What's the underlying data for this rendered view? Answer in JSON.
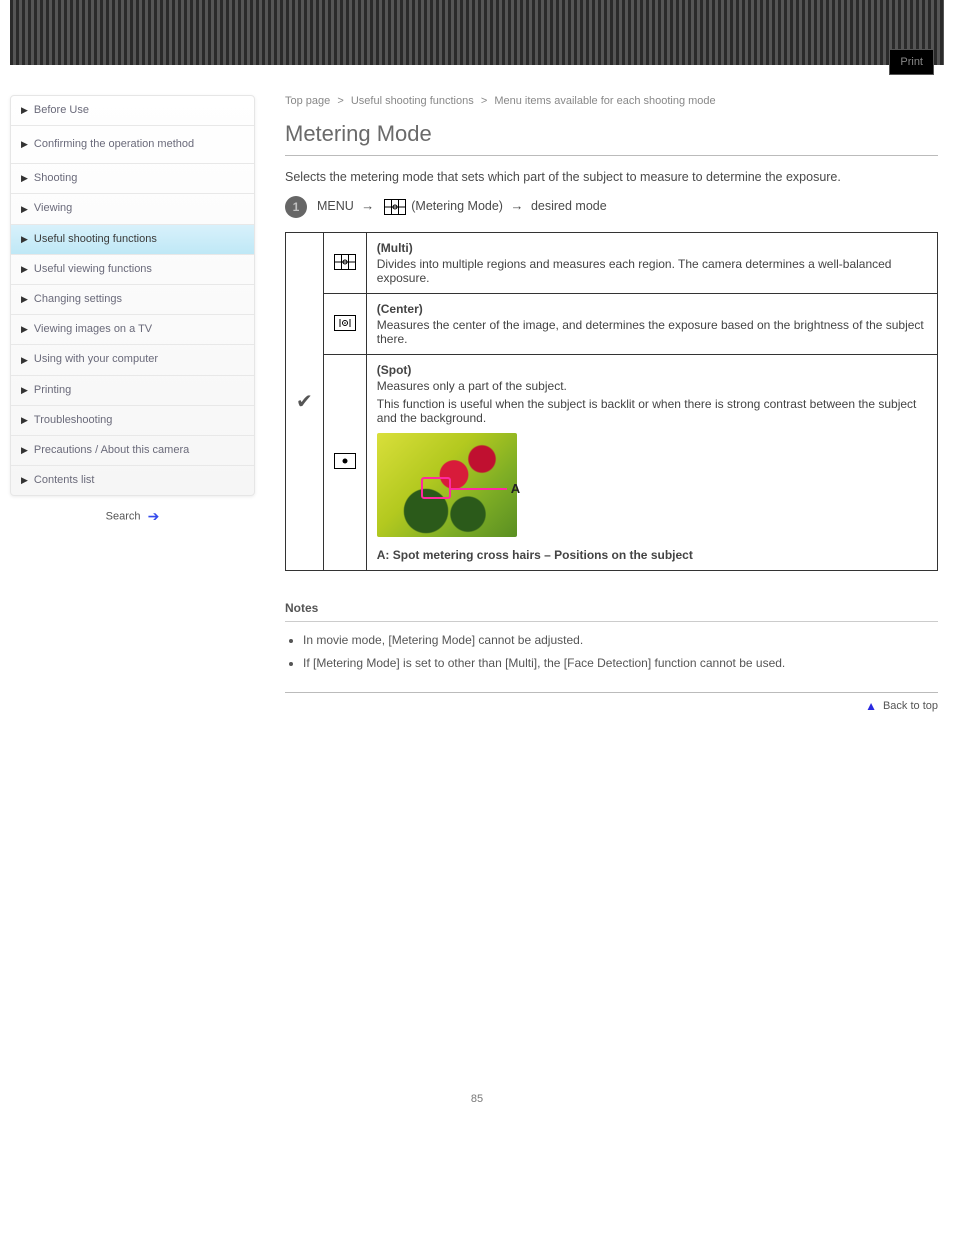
{
  "header": {
    "tag": "Print"
  },
  "sidebar": {
    "items": [
      {
        "label": "Before Use",
        "active": false,
        "double": false
      },
      {
        "label": "Confirming the operation method",
        "active": false,
        "double": true
      },
      {
        "label": "Shooting",
        "active": false,
        "double": false
      },
      {
        "label": "Viewing",
        "active": false,
        "double": false
      },
      {
        "label": "Useful shooting functions",
        "active": true,
        "double": false
      },
      {
        "label": "Useful viewing functions",
        "active": false,
        "double": false
      },
      {
        "label": "Changing settings",
        "active": false,
        "double": false
      },
      {
        "label": "Viewing images on a TV",
        "active": false,
        "double": false
      },
      {
        "label": "Using with your computer",
        "active": false,
        "double": false
      },
      {
        "label": "Printing",
        "active": false,
        "double": false
      },
      {
        "label": "Troubleshooting",
        "active": false,
        "double": false
      },
      {
        "label": "Precautions / About this camera",
        "active": false,
        "double": false
      },
      {
        "label": "Contents list",
        "active": false,
        "double": false
      }
    ],
    "search": "Search"
  },
  "trail": {
    "a": "Top page",
    "b": "Useful shooting functions",
    "c": "Menu items available for each shooting mode"
  },
  "title": "Metering Mode",
  "lead": "Selects the metering mode that sets which part of the subject to measure to determine the exposure.",
  "step": {
    "num": "1",
    "menu": "MENU",
    "metering": "(Metering Mode)",
    "desired": "desired mode"
  },
  "table": {
    "rows": [
      {
        "check": true,
        "icon": "multi",
        "name": "(Multi)",
        "desc": "Divides into multiple regions and measures each region. The camera determines a well-balanced exposure."
      },
      {
        "check": false,
        "icon": "center",
        "name": "(Center)",
        "desc": "Measures the center of the image, and determines the exposure based on the brightness of the subject there."
      },
      {
        "check": false,
        "icon": "spot",
        "name": "(Spot)",
        "desc": "Measures only a part of the subject.",
        "extra": "This function is useful when the subject is backlit or when there is strong contrast between the subject and the background.",
        "frame": "A: Spot metering cross hairs – Positions on the subject",
        "label": "A"
      }
    ]
  },
  "notes": {
    "title": "Notes",
    "items": [
      "In movie mode, [Metering Mode] cannot be adjusted.",
      "If [Metering Mode] is set to other than [Multi], the [Face Detection] function cannot be used."
    ]
  },
  "footer": {
    "back_top": "Back to top"
  },
  "page_number": "85"
}
